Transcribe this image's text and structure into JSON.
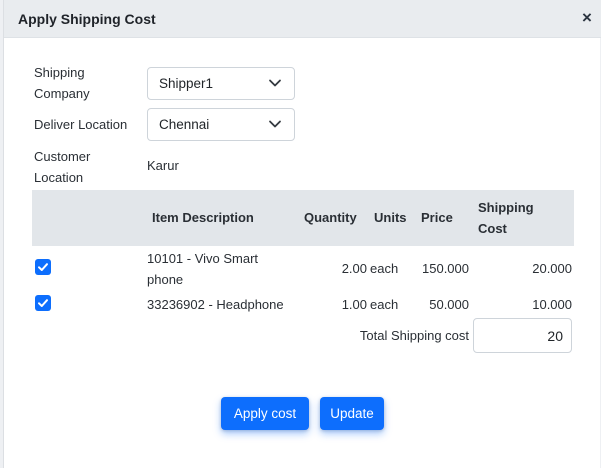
{
  "modal": {
    "title": "Apply Shipping Cost",
    "close_label": "×"
  },
  "form": {
    "shipping_company_label_line1": "Shipping",
    "shipping_company_label_line2": "Company",
    "shipping_company_value": "Shipper1",
    "deliver_location_label": "Deliver Location",
    "deliver_location_value": "Chennai",
    "customer_location_label_line1": "Customer",
    "customer_location_label_line2": "Location",
    "customer_location_value": "Karur"
  },
  "table": {
    "headers": {
      "item_description": "Item Description",
      "quantity": "Quantity",
      "units": "Units",
      "price": "Price",
      "shipping_cost_line1": "Shipping",
      "shipping_cost_line2": "Cost"
    },
    "rows": [
      {
        "checked": true,
        "item_line1": "10101 - Vivo Smart",
        "item_line2": "phone",
        "quantity": "2.00",
        "units": "each",
        "price": "150.000",
        "shipping_cost": "20.000"
      },
      {
        "checked": true,
        "item_line1": "33236902 - Headphone",
        "item_line2": "",
        "quantity": "1.00",
        "units": "each",
        "price": "50.000",
        "shipping_cost": "10.000"
      }
    ],
    "total_label": "Total Shipping cost",
    "total_value": "20"
  },
  "buttons": {
    "apply_cost": "Apply cost",
    "update": "Update"
  },
  "colors": {
    "primary": "#0d6efd",
    "header_bg": "#e9ecef",
    "table_header_bg": "#e2e6ea"
  },
  "icons": {
    "close": "close-icon",
    "dropdown": "chevron-down-icon",
    "check": "check-icon"
  }
}
